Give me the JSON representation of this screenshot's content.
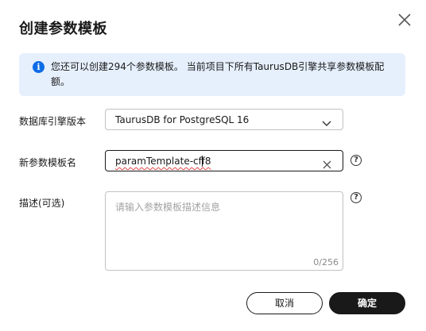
{
  "dialog": {
    "title": "创建参数模板"
  },
  "info": {
    "message": "您还可以创建294个参数模板。 当前项目下所有TaurusDB引擎共享参数模板配额。"
  },
  "form": {
    "engine_version": {
      "label": "数据库引擎版本",
      "value": "TaurusDB for PostgreSQL 16"
    },
    "template_name": {
      "label": "新参数模板名",
      "value": "paramTemplate-cff8"
    },
    "description": {
      "label": "描述(可选)",
      "placeholder": "请输入参数模板描述信息",
      "counter": "0/256"
    }
  },
  "footer": {
    "cancel_label": "取消",
    "confirm_label": "确定"
  },
  "colors": {
    "info_bg": "#e6f0fd",
    "info_icon": "#0d6ce6",
    "primary_button": "#191919",
    "border": "#c2c2c2"
  },
  "icons": [
    "close-icon",
    "info-icon",
    "chevron-down-icon",
    "clear-icon",
    "help-icon"
  ]
}
